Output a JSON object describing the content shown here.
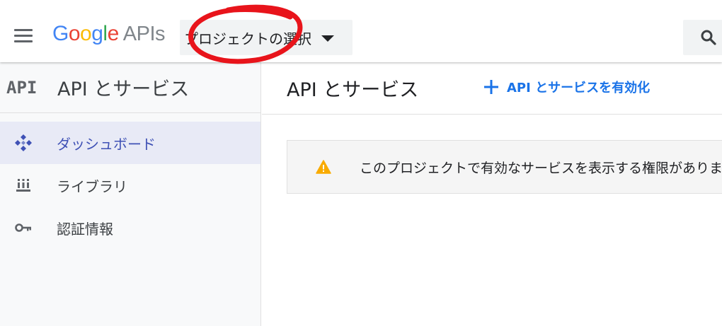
{
  "header": {
    "logo": {
      "g": "G",
      "o1": "o",
      "o2": "o",
      "g2": "g",
      "l": "l",
      "e": "e",
      "apis": "APIs"
    },
    "project_selector": "プロジェクトの選択"
  },
  "sidebar": {
    "api_mark": "API",
    "title": "API とサービス",
    "items": [
      {
        "label": "ダッシュボード",
        "icon": "dashboard-icon",
        "active": true
      },
      {
        "label": "ライブラリ",
        "icon": "library-icon",
        "active": false
      },
      {
        "label": "認証情報",
        "icon": "key-icon",
        "active": false
      }
    ]
  },
  "main": {
    "title": "API とサービス",
    "enable_link": "API とサービスを有効化",
    "notice": "このプロジェクトで有効なサービスを表示する権限がありま"
  },
  "colors": {
    "accent": "#1a73e8",
    "active_nav": "#3f51b5",
    "warning": "#f9ab00",
    "annotation": "#e8141b"
  }
}
